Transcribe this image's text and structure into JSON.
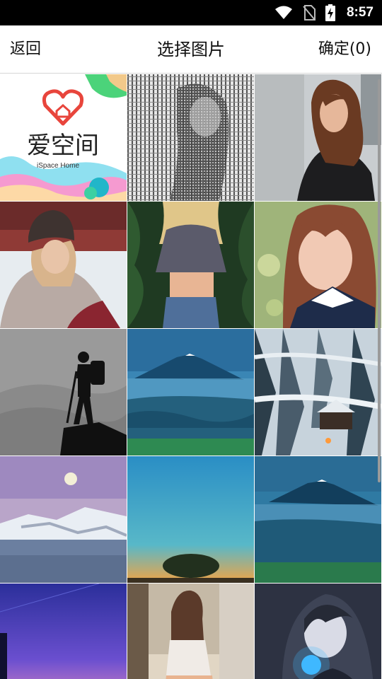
{
  "status_bar": {
    "time": "8:57",
    "icons": [
      "wifi-icon",
      "no-sim-icon",
      "battery-charging-icon"
    ]
  },
  "top_bar": {
    "back_label": "返回",
    "title": "选择图片",
    "confirm_label": "确定(0)"
  },
  "photos": {
    "p1": {
      "brand_cn": "爱空间",
      "brand_en": "iSpace Home",
      "brand_color": "#e8453c"
    }
  }
}
